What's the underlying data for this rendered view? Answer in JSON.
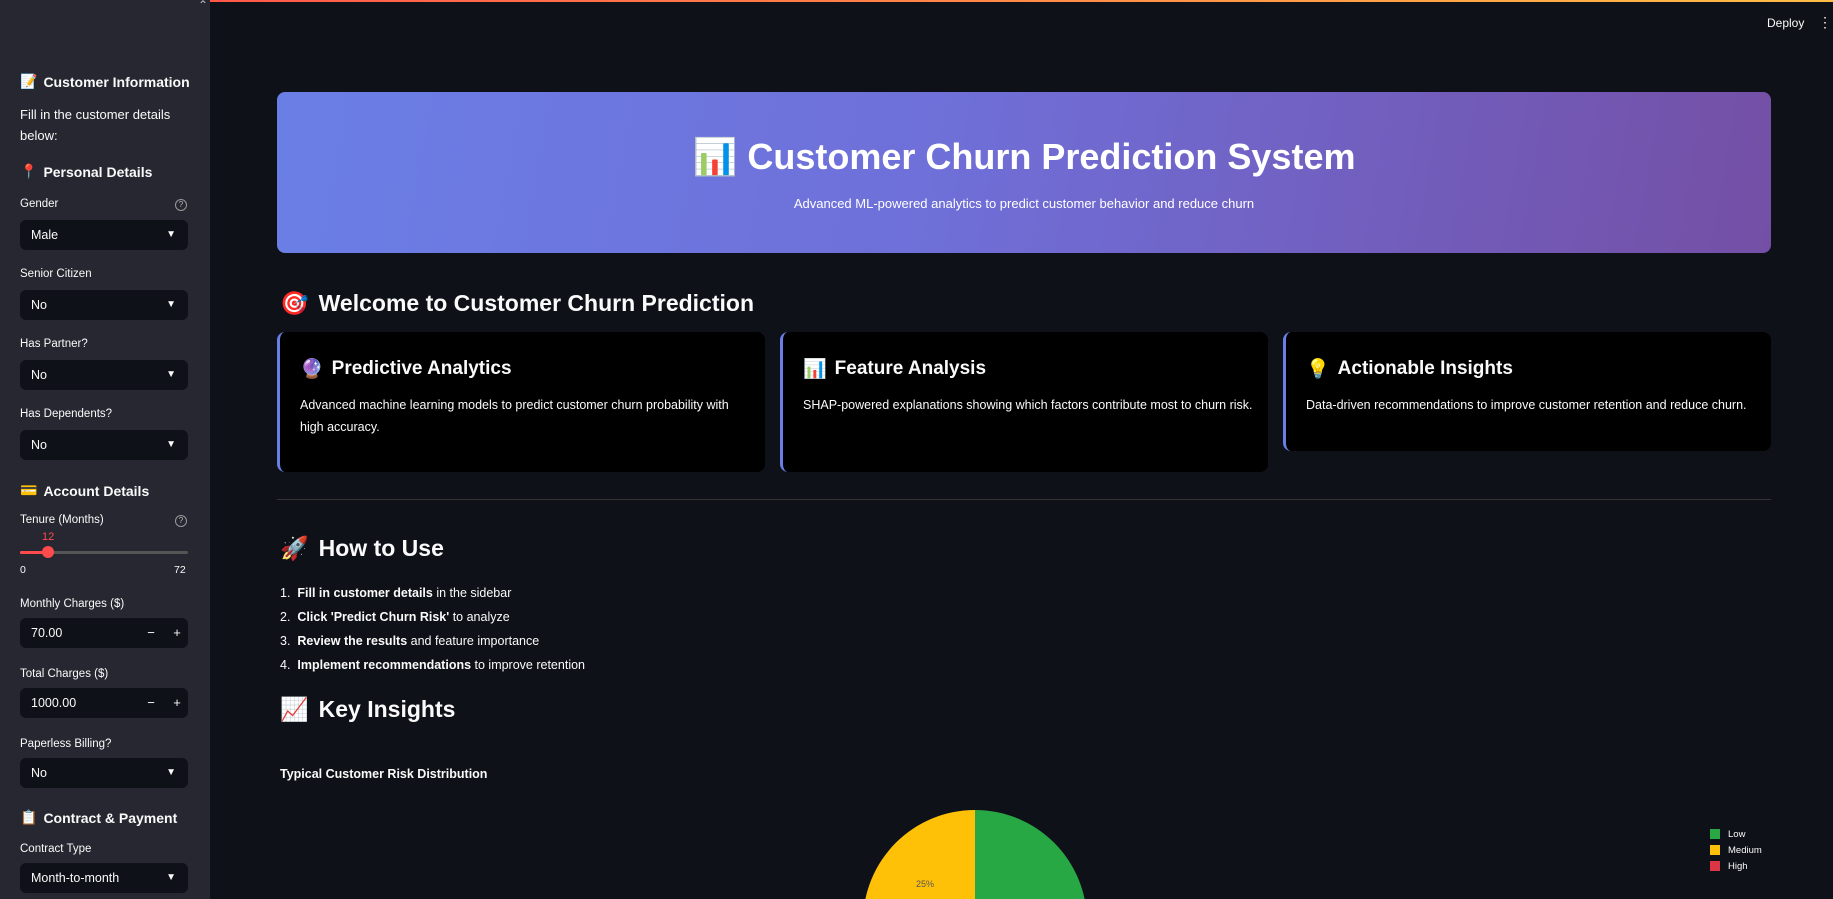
{
  "app": {
    "deploy_label": "Deploy",
    "menu_icon": "kebab-menu-icon"
  },
  "sidebar": {
    "section_customer_info": "Customer Information",
    "intro": "Fill in the customer details below:",
    "section_personal": "Personal Details",
    "gender": {
      "label": "Gender",
      "value": "Male"
    },
    "senior": {
      "label": "Senior Citizen",
      "value": "No"
    },
    "partner": {
      "label": "Has Partner?",
      "value": "No"
    },
    "dependents": {
      "label": "Has Dependents?",
      "value": "No"
    },
    "section_account": "Account Details",
    "tenure": {
      "label": "Tenure (Months)",
      "value": "12",
      "min": "0",
      "max": "72",
      "fraction": 0.1667
    },
    "monthly": {
      "label": "Monthly Charges ($)",
      "value": "70.00"
    },
    "total": {
      "label": "Total Charges ($)",
      "value": "1000.00"
    },
    "paperless": {
      "label": "Paperless Billing?",
      "value": "No"
    },
    "section_contract": "Contract & Payment",
    "contract": {
      "label": "Contract Type",
      "value": "Month-to-month"
    }
  },
  "hero": {
    "title": "Customer Churn Prediction System",
    "subtitle": "Advanced ML-powered analytics to predict customer behavior and reduce churn"
  },
  "welcome": {
    "heading": "Welcome to Customer Churn Prediction",
    "cards": [
      {
        "title": "Predictive Analytics",
        "desc": "Advanced machine learning models to predict customer churn probability with high accuracy."
      },
      {
        "title": "Feature Analysis",
        "desc": "SHAP-powered explanations showing which factors contribute most to churn risk."
      },
      {
        "title": "Actionable Insights",
        "desc": "Data-driven recommendations to improve customer retention and reduce churn."
      }
    ]
  },
  "how_to": {
    "heading": "How to Use",
    "steps": [
      {
        "num": "1.",
        "bold": "Fill in customer details",
        "rest": " in the sidebar"
      },
      {
        "num": "2.",
        "bold": "Click 'Predict Churn Risk'",
        "rest": " to analyze"
      },
      {
        "num": "3.",
        "bold": "Review the results",
        "rest": " and feature importance"
      },
      {
        "num": "4.",
        "bold": "Implement recommendations",
        "rest": " to improve retention"
      }
    ]
  },
  "insights": {
    "heading": "Key Insights"
  },
  "chart_data": {
    "type": "pie",
    "title": "Typical Customer Risk Distribution",
    "categories": [
      "Low",
      "Medium",
      "High"
    ],
    "colors": [
      "#28a745",
      "#ffc107",
      "#dc3545"
    ],
    "visible_slices": [
      {
        "name": "Medium",
        "label": "25%"
      }
    ],
    "legend_position": "top-right"
  }
}
